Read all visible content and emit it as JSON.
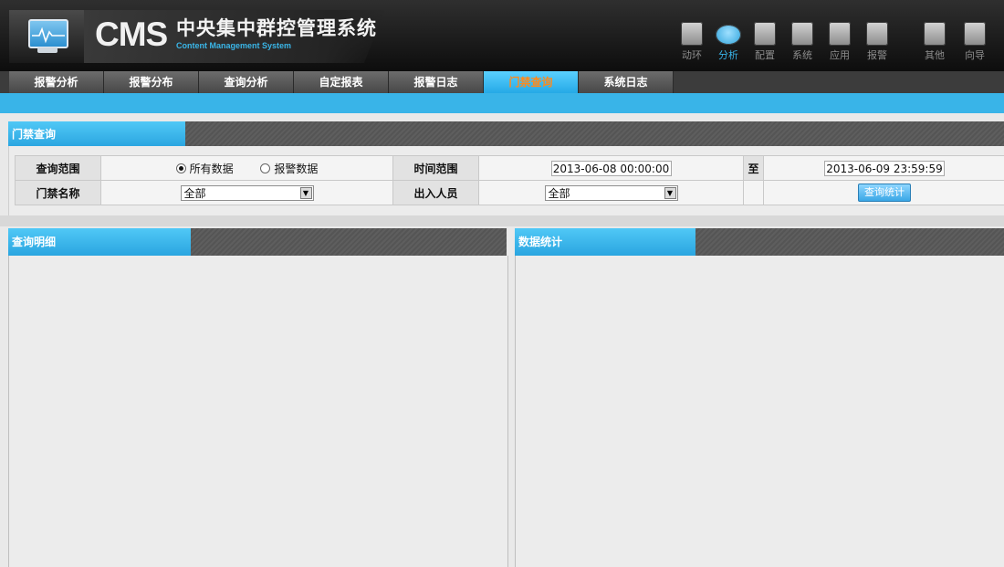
{
  "header": {
    "brand": "CMS",
    "title_cn": "中央集中群控管理系统",
    "title_en": "Content Management System"
  },
  "topnav": [
    {
      "label": "动环",
      "icon": "power-env-icon",
      "active": false
    },
    {
      "label": "分析",
      "icon": "analysis-icon",
      "active": true
    },
    {
      "label": "配置",
      "icon": "config-icon",
      "active": false
    },
    {
      "label": "系统",
      "icon": "system-icon",
      "active": false
    },
    {
      "label": "应用",
      "icon": "application-icon",
      "active": false
    },
    {
      "label": "报警",
      "icon": "alarm-icon",
      "active": false
    },
    {
      "label": "其他",
      "icon": "other-icon",
      "active": false
    },
    {
      "label": "向导",
      "icon": "wizard-icon",
      "active": false
    }
  ],
  "tabs": [
    {
      "label": "报警分析",
      "active": false
    },
    {
      "label": "报警分布",
      "active": false
    },
    {
      "label": "查询分析",
      "active": false
    },
    {
      "label": "自定报表",
      "active": false
    },
    {
      "label": "报警日志",
      "active": false
    },
    {
      "label": "门禁查询",
      "active": true
    },
    {
      "label": "系统日志",
      "active": false
    }
  ],
  "query_panel": {
    "title": "门禁查询",
    "range_label": "查询范围",
    "radio_all": "所有数据",
    "radio_alarm": "报警数据",
    "time_range_label": "时间范围",
    "start_time": "2013-06-08 00:00:00",
    "to_label": "至",
    "end_time": "2013-06-09 23:59:59",
    "door_name_label": "门禁名称",
    "door_name_value": "全部",
    "person_label": "出入人员",
    "person_value": "全部",
    "query_button": "查询统计"
  },
  "detail_panel": {
    "title": "查询明细"
  },
  "stats_panel": {
    "title": "数据统计"
  },
  "colors": {
    "accent": "#39b4e8",
    "active_tab_text": "#ff8a1c",
    "header_bg": "#111111"
  }
}
